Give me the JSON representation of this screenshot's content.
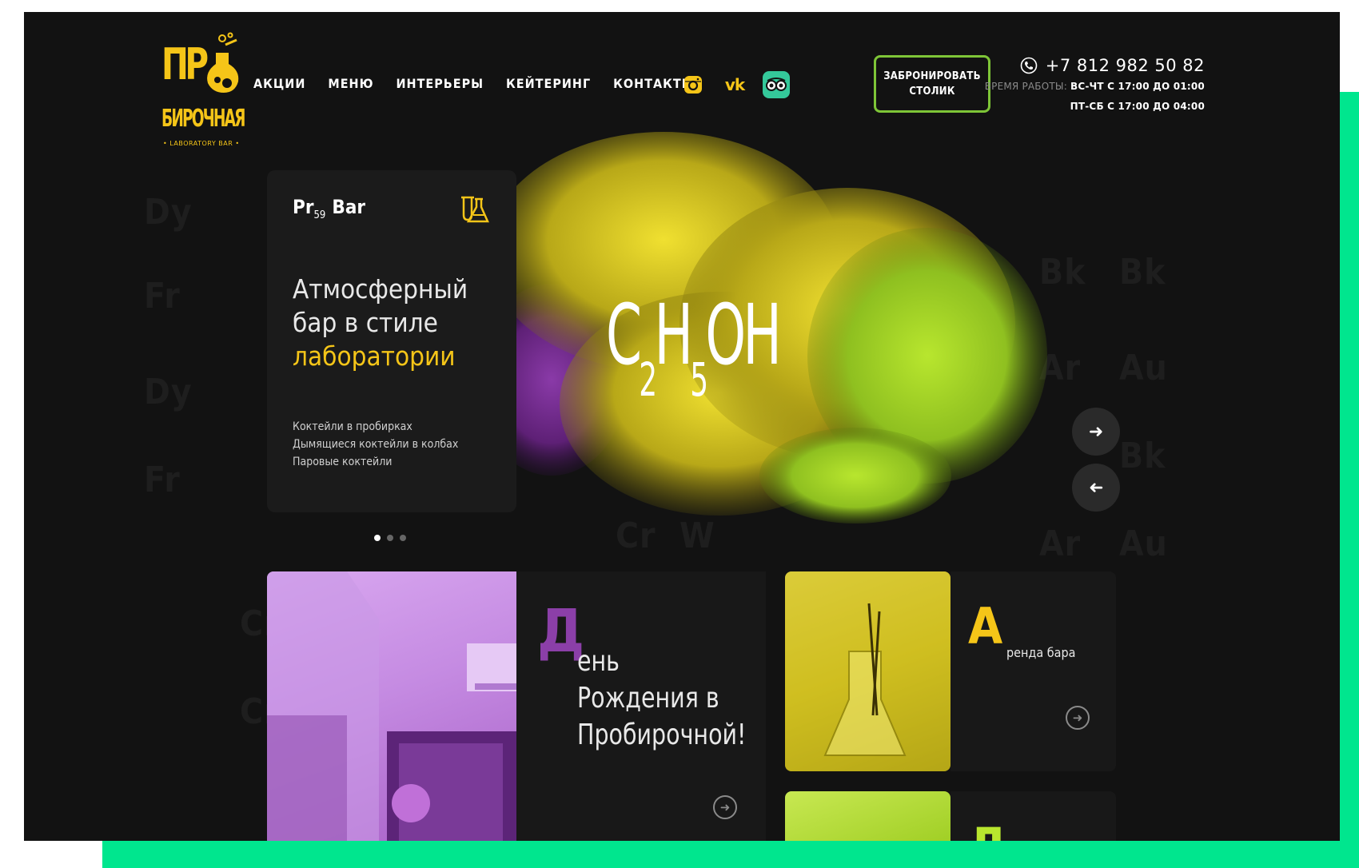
{
  "brand": {
    "logo_line1": "ПР",
    "logo_line2": "БИРОЧНАЯ",
    "logo_sub": "• LABORATORY BAR •"
  },
  "nav": {
    "items": [
      {
        "label": "АКЦИИ"
      },
      {
        "label": "МЕНЮ"
      },
      {
        "label": "ИНТЕРЬЕРЫ"
      },
      {
        "label": "КЕЙТЕРИНГ"
      },
      {
        "label": "КОНТАКТЫ"
      }
    ]
  },
  "social": {
    "icons": [
      "instagram-icon",
      "vk-icon",
      "tripadvisor-icon"
    ],
    "vk_label": "vk"
  },
  "booking": {
    "label": "ЗАБРОНИРОВАТЬ\nСТОЛИК"
  },
  "contact": {
    "phone": "+7 812 982 50 82",
    "hours_label": "ВРЕМЯ РАБОТЫ:",
    "hours_weekday": "ВС-ЧТ С 17:00 ДО 01:00",
    "hours_weekend": "ПТ-СБ С 17:00 ДО 04:00"
  },
  "hero": {
    "formula_parts": [
      "C",
      "2",
      "H",
      "5",
      "OH"
    ],
    "card": {
      "title_pr": "Pr",
      "title_num": "59",
      "title_bar": "Bar",
      "head_line1": "Атмосферный",
      "head_line2": "бар в стиле",
      "head_highlight": "лаборатории",
      "features": [
        "Коктейли в пробирках",
        "Дымящиеся коктейли в колбах",
        "Паровые коктейли"
      ]
    },
    "slides_count": 3,
    "active_slide": 1
  },
  "tiles": {
    "birthday": {
      "initial": "Д",
      "text": "ень\nРождения в\nПробирочной!"
    },
    "rent": {
      "initial": "А",
      "text": "ренда бара"
    },
    "third": {
      "initial": "Д"
    }
  },
  "colors": {
    "accent_yellow": "#f5c518",
    "accent_green": "#7ec537",
    "frame_green": "#00e68e",
    "purple": "#8b3fa8",
    "background": "#121212"
  }
}
